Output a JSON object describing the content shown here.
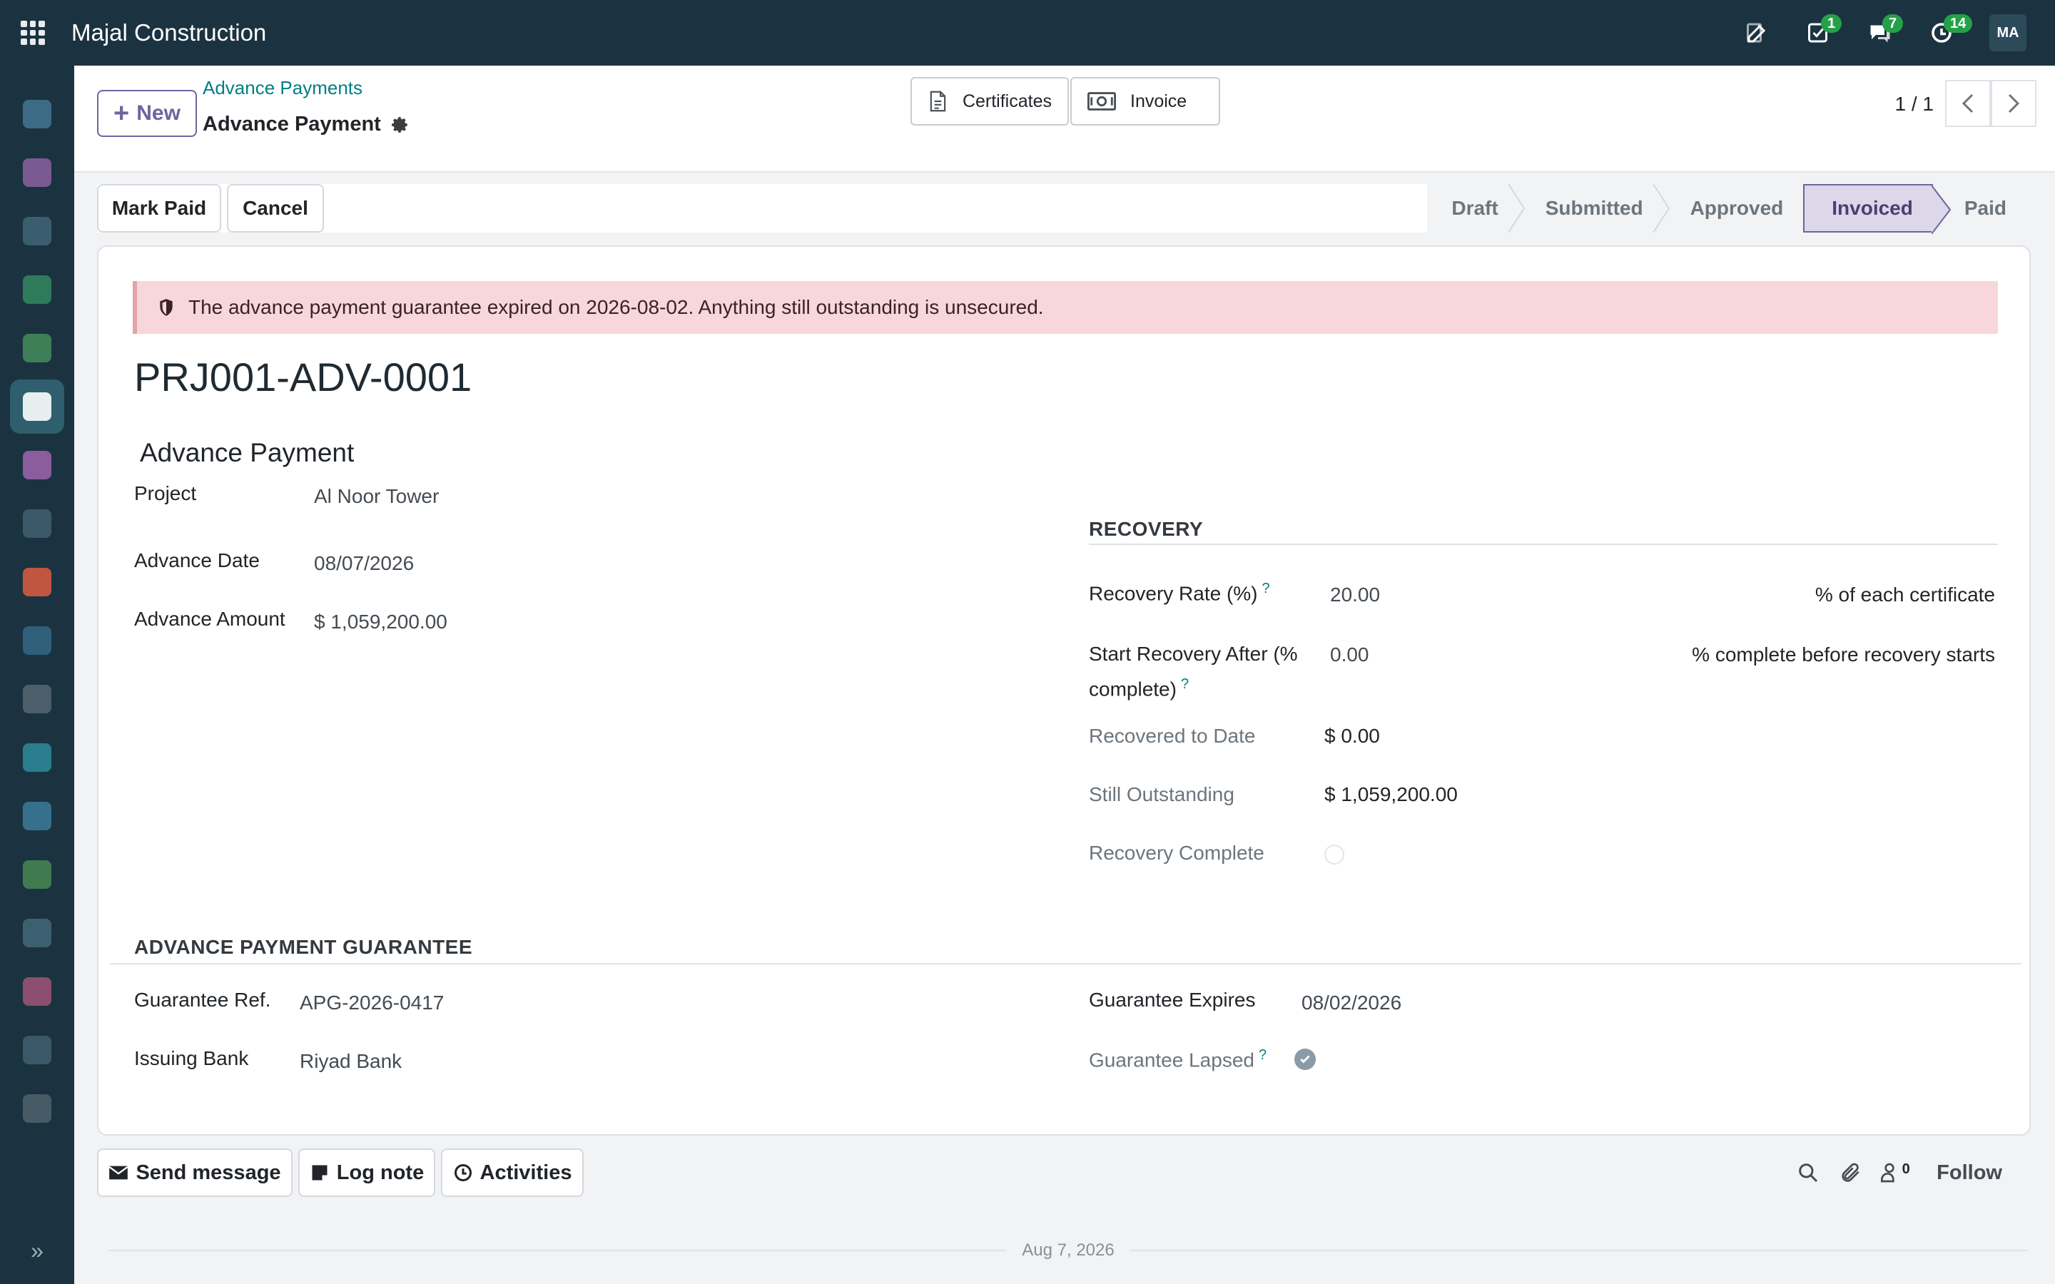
{
  "app": {
    "title": "Majal Construction",
    "user_initials": "MA"
  },
  "systray": {
    "activities_count": "1",
    "messages_count": "7",
    "activity_clock_count": "14"
  },
  "control_panel": {
    "new_label": "New",
    "breadcrumb_parent": "Advance Payments",
    "breadcrumb_current": "Advance Payment",
    "smart_buttons": [
      {
        "label": "Certificates"
      },
      {
        "label": "Invoice"
      }
    ],
    "pager": "1 / 1"
  },
  "actions": {
    "mark_paid": "Mark Paid",
    "cancel": "Cancel"
  },
  "statusbar": {
    "stages": [
      "Draft",
      "Submitted",
      "Approved",
      "Invoiced",
      "Paid"
    ],
    "current": "Invoiced"
  },
  "alert": {
    "text": "The advance payment guarantee expired on 2026-08-02. Anything still outstanding is unsecured."
  },
  "record": {
    "name": "PRJ001-ADV-0001",
    "group_title": "Advance Payment",
    "project_label": "Project",
    "project": "Al Noor Tower",
    "advance_date_label": "Advance Date",
    "advance_date": "08/07/2026",
    "advance_amount_label": "Advance Amount",
    "advance_amount": "$ 1,059,200.00"
  },
  "recovery": {
    "title": "RECOVERY",
    "rate_label": "Recovery Rate (%)",
    "rate": "20.00",
    "rate_hint": "% of each certificate",
    "start_label_1": "Start Recovery After (%",
    "start_label_2": "complete)",
    "start": "0.00",
    "start_hint": "% complete before recovery starts",
    "recovered_label": "Recovered to Date",
    "recovered": "$ 0.00",
    "outstanding_label": "Still Outstanding",
    "outstanding": "$ 1,059,200.00",
    "complete_label": "Recovery Complete",
    "complete": false
  },
  "guarantee": {
    "title": "ADVANCE PAYMENT GUARANTEE",
    "ref_label": "Guarantee Ref.",
    "ref": "APG-2026-0417",
    "bank_label": "Issuing Bank",
    "bank": "Riyad Bank",
    "expires_label": "Guarantee Expires",
    "expires": "08/02/2026",
    "lapsed_label": "Guarantee Lapsed",
    "lapsed": true
  },
  "chatter": {
    "send_message": "Send message",
    "log_note": "Log note",
    "activities": "Activities",
    "followers_count": "0",
    "follow": "Follow",
    "date_separator": "Aug 7, 2026"
  },
  "colors": {
    "topbar": "#1b3340",
    "accent": "#71639e",
    "link": "#017e84",
    "alert_bg": "#f8d7da"
  }
}
